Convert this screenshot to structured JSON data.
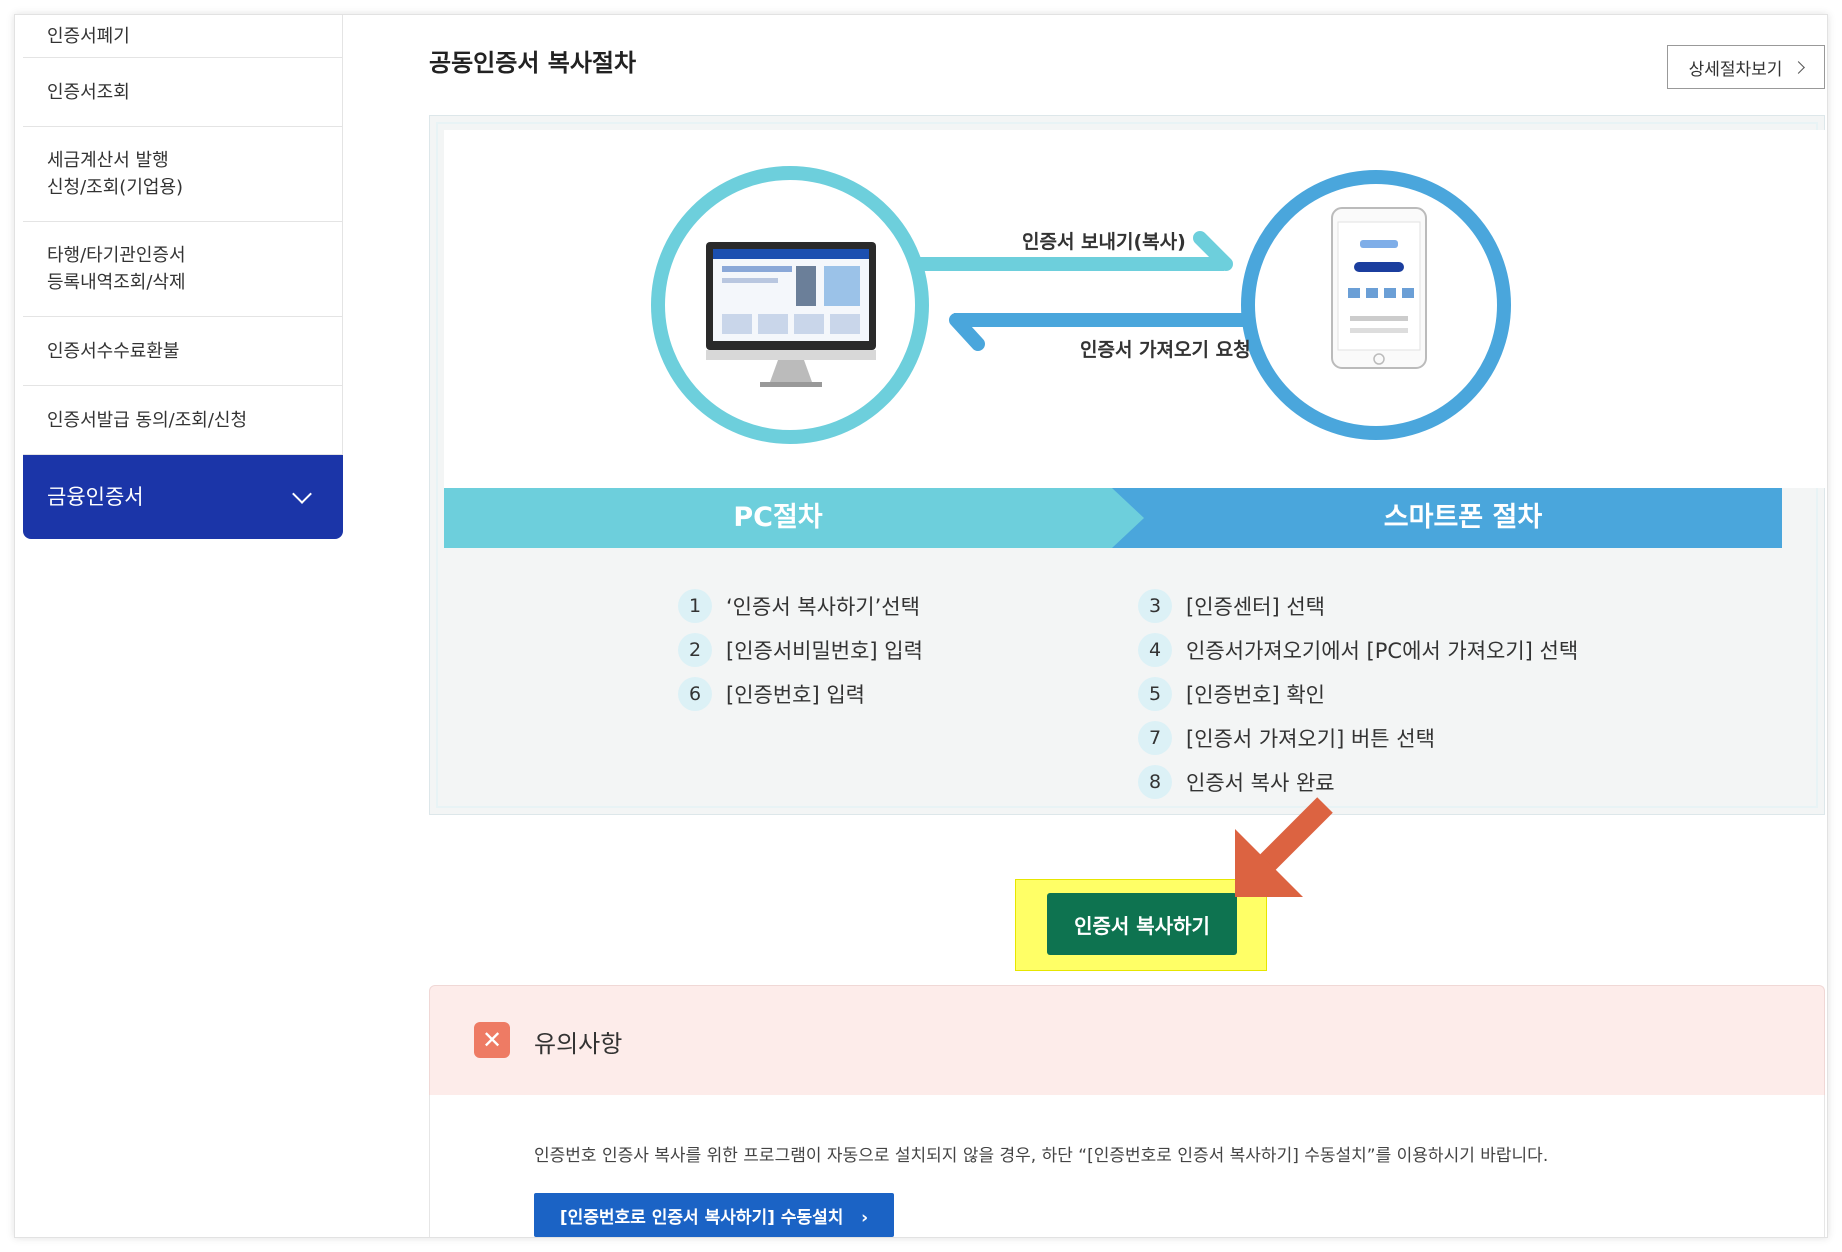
{
  "sidebar": {
    "items": [
      {
        "label": "인증서폐기"
      },
      {
        "label": "인증서조회"
      },
      {
        "line1": "세금계산서 발행",
        "line2": "신청/조회(기업용)"
      },
      {
        "line1": "타행/타기관인증서",
        "line2": "등록내역조회/삭제"
      },
      {
        "label": "인증서수수료환불"
      },
      {
        "label": "인증서발급 동의/조회/신청"
      },
      {
        "label": "금융인증서"
      }
    ]
  },
  "main": {
    "title": "공동인증서 복사절차",
    "detail_button": "상세절차보기",
    "illustration": {
      "send_label": "인증서 보내기(복사)",
      "request_label": "인증서 가져오기 요청"
    },
    "pc_band": "PC절차",
    "phone_band": "스마트폰 절차",
    "pc_steps": [
      {
        "num": "1",
        "text": "‘인증서 복사하기’선택"
      },
      {
        "num": "2",
        "text": "[인증서비밀번호] 입력"
      },
      {
        "num": "6",
        "text": "[인증번호] 입력"
      }
    ],
    "phone_steps": [
      {
        "num": "3",
        "text": "[인증센터] 선택"
      },
      {
        "num": "4",
        "text": "인증서가져오기에서 [PC에서 가져오기] 선택"
      },
      {
        "num": "5",
        "text": "[인증번호] 확인"
      },
      {
        "num": "7",
        "text": "[인증서 가져오기] 버튼 선택"
      },
      {
        "num": "8",
        "text": "인증서 복사 완료"
      }
    ],
    "copy_button": "인증서 복사하기"
  },
  "notice": {
    "icon": "close-icon",
    "title": "유의사항",
    "text": "인증번호 인증사 복사를 위한 프로그램이 자동으로 설치되지 않을 경우, 하단 “[인증번호로 인증서 복사하기] 수동설치”를 이용하시기 바랍니다.",
    "install_button": "[인증번호로 인증서 복사하기] 수동설치"
  },
  "colors": {
    "sidebar_active": "#1b35a8",
    "band_pc": "#6dcfdc",
    "band_phone": "#4aa6dc",
    "copy_button": "#0e7350",
    "highlight": "#ffff66",
    "arrow": "#dc6341",
    "notice_bg": "#fdecea",
    "install_button": "#1b63c5"
  }
}
